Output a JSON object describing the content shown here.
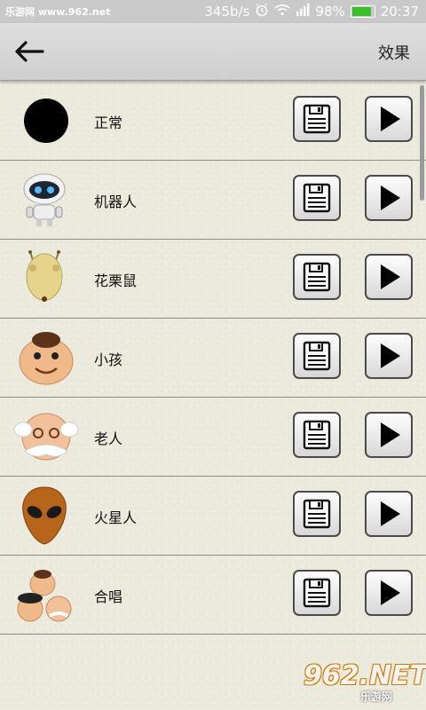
{
  "status_bar": {
    "site_label": "乐游网 www.962.net",
    "net_speed": "345b/s",
    "battery": "98%",
    "battery_level": 0.98,
    "time": "20:37"
  },
  "header": {
    "title": "效果"
  },
  "rows": [
    {
      "label": "正常",
      "avatar": "black-circle"
    },
    {
      "label": "机器人",
      "avatar": "robot-icon"
    },
    {
      "label": "花栗鼠",
      "avatar": "chipmunk-icon"
    },
    {
      "label": "小孩",
      "avatar": "child-face-icon"
    },
    {
      "label": "老人",
      "avatar": "old-man-face-icon"
    },
    {
      "label": "火星人",
      "avatar": "alien-face-icon"
    },
    {
      "label": "合唱",
      "avatar": "chorus-group-icon"
    }
  ],
  "watermark": {
    "logo": "962.NET",
    "sub": "乐游网"
  }
}
